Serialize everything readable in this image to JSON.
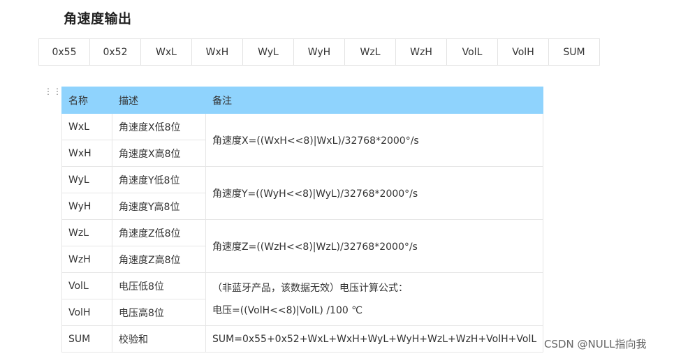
{
  "heading": "角速度输出",
  "bytes": [
    "0x55",
    "0x52",
    "WxL",
    "WxH",
    "WyL",
    "WyH",
    "WzL",
    "WzH",
    "VolL",
    "VolH",
    "SUM"
  ],
  "table": {
    "headers": [
      "名称",
      "描述",
      "备注"
    ],
    "rows": [
      {
        "name": "WxL",
        "desc": "角速度X低8位"
      },
      {
        "name": "WxH",
        "desc": "角速度X高8位"
      },
      {
        "name": "WyL",
        "desc": "角速度Y低8位"
      },
      {
        "name": "WyH",
        "desc": "角速度Y高8位"
      },
      {
        "name": "WzL",
        "desc": "角速度Z低8位"
      },
      {
        "name": "WzH",
        "desc": "角速度Z高8位"
      },
      {
        "name": "VolL",
        "desc": "电压低8位"
      },
      {
        "name": "VolH",
        "desc": "电压高8位"
      },
      {
        "name": "SUM",
        "desc": "校验和"
      }
    ],
    "notes": {
      "wx": "角速度X=((WxH<<8)|WxL)/32768*2000°/s",
      "wy": "角速度Y=((WyH<<8)|WyL)/32768*2000°/s",
      "wz": "角速度Z=((WzH<<8)|WzL)/32768*2000°/s",
      "vol_line1": "（非蓝牙产品，该数据无效）电压计算公式：",
      "vol_line2": "电压=((VolH<<8)|VolL) /100 ℃",
      "sum": "SUM=0x55+0x52+WxL+WxH+WyL+WyH+WzL+WzH+VolH+VolL"
    }
  },
  "watermark": "CSDN @NULL指向我"
}
